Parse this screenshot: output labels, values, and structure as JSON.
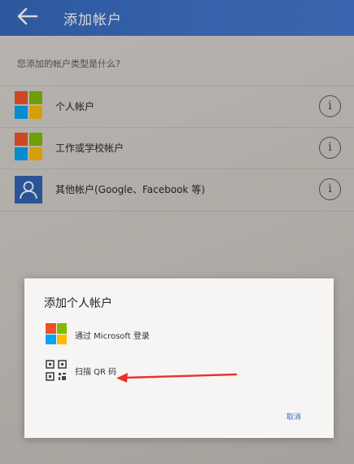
{
  "header": {
    "title": "添加帐户"
  },
  "prompt": "您添加的帐户类型是什么?",
  "accounts": [
    {
      "label": "个人帐户",
      "icon": "microsoft-logo-icon"
    },
    {
      "label": "工作或学校帐户",
      "icon": "microsoft-logo-icon"
    },
    {
      "label": "其他帐户(Google、Facebook 等)",
      "icon": "person-icon"
    }
  ],
  "info_glyph": "i",
  "dialog": {
    "title": "添加个人帐户",
    "option_microsoft": "通过 Microsoft 登录",
    "option_qr": "扫描 QR 码",
    "cancel": "取消"
  },
  "colors": {
    "header": "#3468bf",
    "ms_red": "#f25022",
    "ms_green": "#7fba00",
    "ms_blue": "#00a4ef",
    "ms_yellow": "#ffb900",
    "arrow": "#e8322c"
  }
}
